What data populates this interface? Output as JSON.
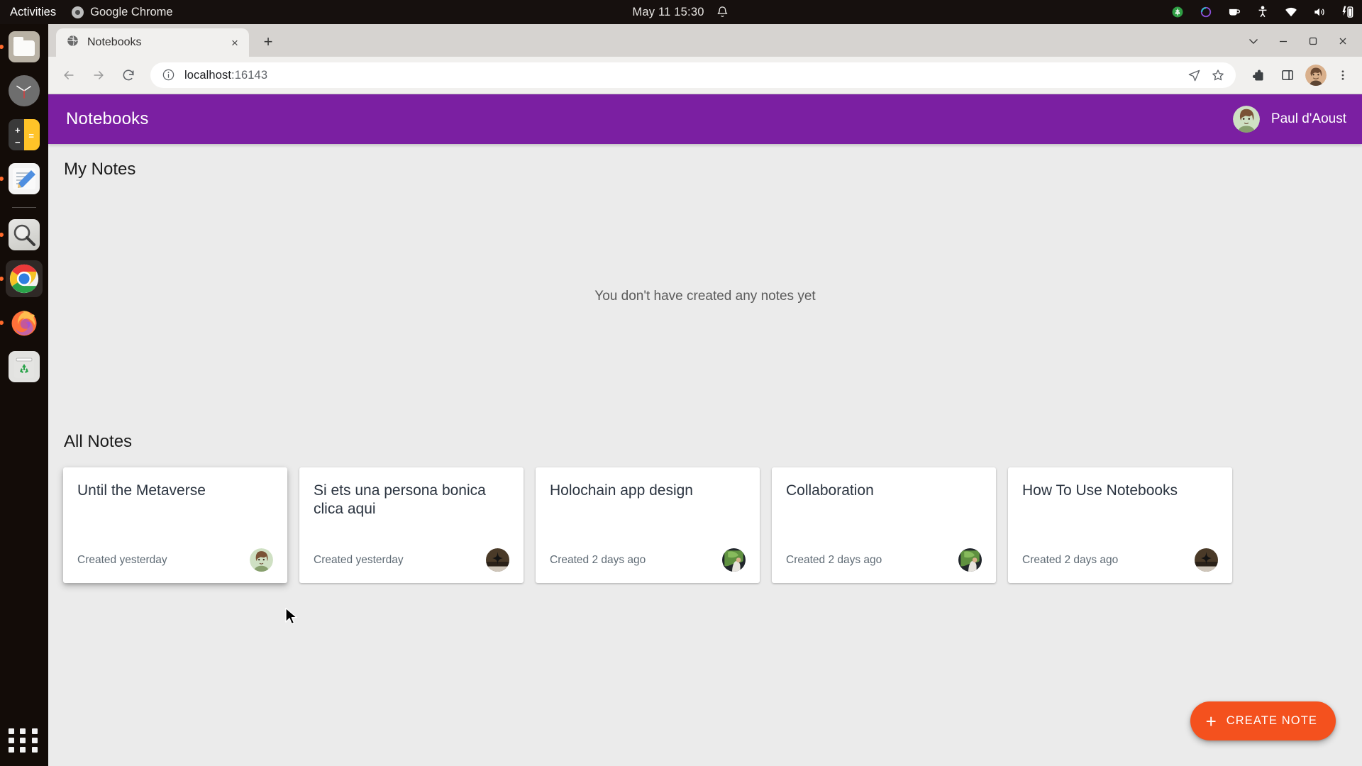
{
  "desktop": {
    "activities_label": "Activities",
    "active_app": "Google Chrome",
    "clock": "May 11  15:30",
    "tray_icons": [
      "notifications-bell-icon",
      "network-shield-icon",
      "sync-circle-icon",
      "coffee-icon",
      "accessibility-icon",
      "wifi-icon",
      "volume-icon",
      "battery-icon"
    ],
    "dock_items": [
      {
        "name": "files",
        "label": "Files",
        "running": true
      },
      {
        "name": "clock",
        "label": "Clocks",
        "running": false
      },
      {
        "name": "calculator",
        "label": "Calculator",
        "running": false
      },
      {
        "name": "text-editor",
        "label": "Text Editor",
        "running": true
      },
      {
        "name": "search",
        "label": "Search",
        "running": true
      },
      {
        "name": "google-chrome",
        "label": "Google Chrome",
        "running": true,
        "active": true
      },
      {
        "name": "firefox",
        "label": "Firefox",
        "running": true
      },
      {
        "name": "trash",
        "label": "Trash",
        "running": false
      }
    ],
    "app_grid_label": "Show Applications"
  },
  "browser": {
    "tab_title": "Notebooks",
    "tab_close_label": "×",
    "new_tab_label": "+",
    "window_controls": {
      "minimize": "–",
      "maximize": "❐",
      "close": "✕",
      "tab_search": "⌄"
    },
    "url": "localhost",
    "url_suffix": ":16143",
    "back_label": "back-arrow",
    "forward_label": "forward-arrow",
    "reload_label": "reload"
  },
  "app": {
    "title": "Notebooks",
    "user_name": "Paul d'Aoust",
    "my_notes_heading": "My Notes",
    "empty_state": "You don't have created any notes yet",
    "all_notes_heading": "All Notes",
    "notes": [
      {
        "title": "Until the Metaverse",
        "date": "Created yesterday",
        "avatar": "paul"
      },
      {
        "title": "Si ets una persona bonica clica aqui",
        "date": "Created yesterday",
        "avatar": "dark-star"
      },
      {
        "title": "Holochain app design",
        "date": "Created 2 days ago",
        "avatar": "foliage"
      },
      {
        "title": "Collaboration",
        "date": "Created 2 days ago",
        "avatar": "foliage"
      },
      {
        "title": "How To Use Notebooks",
        "date": "Created 2 days ago",
        "avatar": "dark-star"
      }
    ],
    "create_button": {
      "plus": "+",
      "label": "CREATE NOTE"
    },
    "colors": {
      "header": "#7b1fa2",
      "fab": "#f4511e",
      "page_bg": "#ebebeb",
      "card_bg": "#ffffff"
    }
  }
}
